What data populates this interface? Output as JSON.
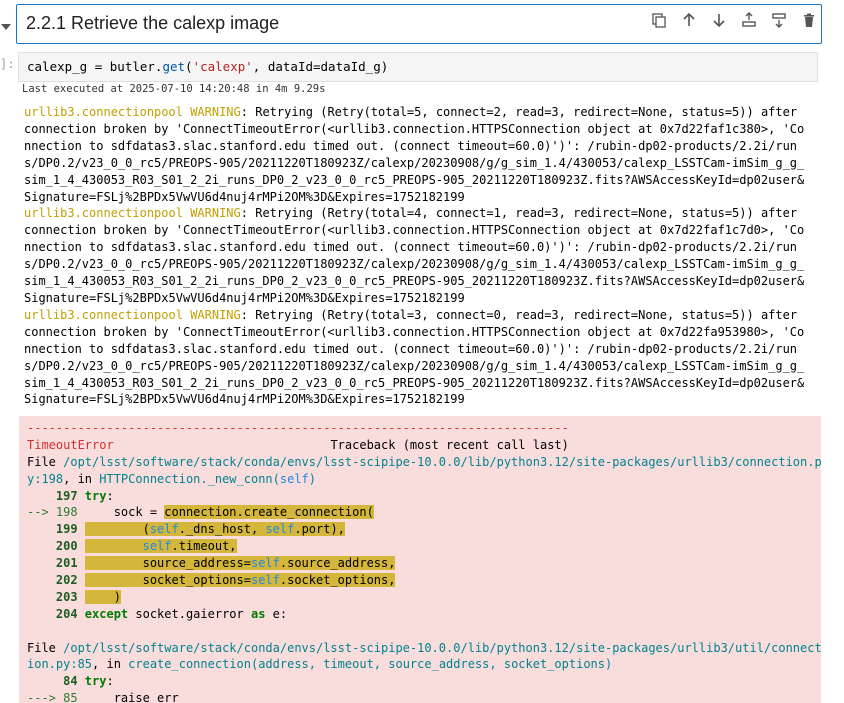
{
  "markdown_cell": {
    "title": "2.2.1 Retrieve the calexp image",
    "toolbar": [
      {
        "name": "duplicate-cell-icon"
      },
      {
        "name": "move-up-icon"
      },
      {
        "name": "move-down-icon"
      },
      {
        "name": "insert-above-icon"
      },
      {
        "name": "insert-below-icon"
      },
      {
        "name": "delete-cell-icon"
      }
    ]
  },
  "code_cell": {
    "prompt": "]:",
    "code_parts": {
      "a": "calexp_g = butler.",
      "b": "get",
      "c": "(",
      "d": "'calexp'",
      "e": ", dataId=dataId_g)"
    },
    "last_executed": "Last executed at 2025-07-10 14:20:48 in 4m 9.29s"
  },
  "warnings": [
    {
      "source": "urllib3.connectionpool",
      "level": "WARNING",
      "first": ": Retrying (Retry(total=5, connect=2, read=3, redirect=None, status=5)) after",
      "lines": [
        "connection broken by 'ConnectTimeoutError(<urllib3.connection.HTTPSConnection object at 0x7d22faf1c380>, 'Co",
        "nnection to sdfdatas3.slac.stanford.edu timed out. (connect timeout=60.0)')': /rubin-dp02-products/2.2i/run",
        "s/DP0.2/v23_0_0_rc5/PREOPS-905/20211220T180923Z/calexp/20230908/g/g_sim_1.4/430053/calexp_LSSTCam-imSim_g_g_",
        "sim_1_4_430053_R03_S01_2_2i_runs_DP0_2_v23_0_0_rc5_PREOPS-905_20211220T180923Z.fits?AWSAccessKeyId=dp02user&",
        "Signature=FSLj%2BPDx5VwVU6d4nuj4rMPi2OM%3D&Expires=1752182199"
      ]
    },
    {
      "source": "urllib3.connectionpool",
      "level": "WARNING",
      "first": ": Retrying (Retry(total=4, connect=1, read=3, redirect=None, status=5)) after",
      "lines": [
        "connection broken by 'ConnectTimeoutError(<urllib3.connection.HTTPSConnection object at 0x7d22faf1c7d0>, 'Co",
        "nnection to sdfdatas3.slac.stanford.edu timed out. (connect timeout=60.0)')': /rubin-dp02-products/2.2i/run",
        "s/DP0.2/v23_0_0_rc5/PREOPS-905/20211220T180923Z/calexp/20230908/g/g_sim_1.4/430053/calexp_LSSTCam-imSim_g_g_",
        "sim_1_4_430053_R03_S01_2_2i_runs_DP0_2_v23_0_0_rc5_PREOPS-905_20211220T180923Z.fits?AWSAccessKeyId=dp02user&",
        "Signature=FSLj%2BPDx5VwVU6d4nuj4rMPi2OM%3D&Expires=1752182199"
      ]
    },
    {
      "source": "urllib3.connectionpool",
      "level": "WARNING",
      "first": ": Retrying (Retry(total=3, connect=0, read=3, redirect=None, status=5)) after",
      "lines": [
        "connection broken by 'ConnectTimeoutError(<urllib3.connection.HTTPSConnection object at 0x7d22fa953980>, 'Co",
        "nnection to sdfdatas3.slac.stanford.edu timed out. (connect timeout=60.0)')': /rubin-dp02-products/2.2i/run",
        "s/DP0.2/v23_0_0_rc5/PREOPS-905/20211220T180923Z/calexp/20230908/g/g_sim_1.4/430053/calexp_LSSTCam-imSim_g_g_",
        "sim_1_4_430053_R03_S01_2_2i_runs_DP0_2_v23_0_0_rc5_PREOPS-905_20211220T180923Z.fits?AWSAccessKeyId=dp02user&",
        "Signature=FSLj%2BPDx5VwVU6d4nuj4rMPi2OM%3D&Expires=1752182199"
      ]
    }
  ],
  "traceback": {
    "dashes": "---------------------------------------------------------------------------",
    "error_name": "TimeoutError",
    "header_spacing": "                              ",
    "header": "Traceback (most recent call last)",
    "frame1": {
      "file_label": "File ",
      "path_a": "/opt/lsst/software/stack/conda/envs/lsst-scipipe-10.0.0/lib/python3.12/site-packages/urllib3/connection.p",
      "path_b": "y:198",
      "in_label": ", in ",
      "func": "HTTPConnection._new_conn",
      "func_args_open": "(",
      "func_args_self": "self",
      "func_args_close": ")"
    },
    "code1": {
      "l197_num": "    197 ",
      "l197_kw": "try",
      "l197_rest": ":",
      "arrow": "--> 198 ",
      "l198_pre": "    sock = ",
      "l198_hl": "connection.create_connection(",
      "l199_num": "    199 ",
      "l199_hl_a": "        (",
      "l199_hl_b": "self",
      "l199_hl_c": "._dns_host, ",
      "l199_hl_d": "self",
      "l199_hl_e": ".port),",
      "l200_num": "    200 ",
      "l200_hl_a": "        ",
      "l200_hl_b": "self",
      "l200_hl_c": ".timeout,",
      "l201_num": "    201 ",
      "l201_hl_a": "        source_address=",
      "l201_hl_b": "self",
      "l201_hl_c": ".source_address,",
      "l202_num": "    202 ",
      "l202_hl_a": "        socket_options=",
      "l202_hl_b": "self",
      "l202_hl_c": ".socket_options,",
      "l203_num": "    203 ",
      "l203_hl": "    )",
      "l204_num": "    204 ",
      "l204_kw": "except",
      "l204_rest_a": " socket.gaierror ",
      "l204_kw2": "as",
      "l204_rest_b": " e:"
    },
    "frame2": {
      "file_label": "File ",
      "path_a": "/opt/lsst/software/stack/conda/envs/lsst-scipipe-10.0.0/lib/python3.12/site-packages/urllib3/util/connect",
      "path_b": "ion.py:85",
      "in_label": ", in ",
      "func": "create_connection",
      "args": "(address, timeout, source_address, socket_options)"
    },
    "code2": {
      "l84_num": "     84 ",
      "l84_kw": "try",
      "l84_rest": ":",
      "l85_arrow": "---> 85 ",
      "l85_code": "    raise err"
    }
  }
}
